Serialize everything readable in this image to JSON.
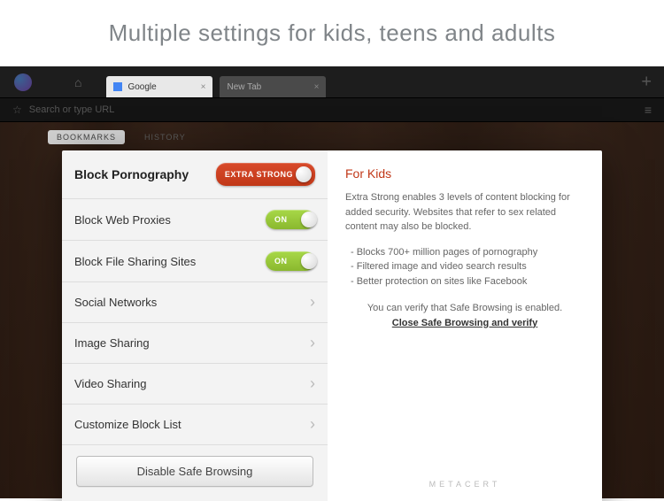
{
  "banner_text": "Multiple settings for kids, teens and adults",
  "browser": {
    "tab_active_label": "Google",
    "tab_inactive_label": "New Tab",
    "url_placeholder": "Search or type URL"
  },
  "sub_tabs": {
    "bookmarks": "BOOKMARKS",
    "history": "HISTORY"
  },
  "settings": {
    "block_porn": {
      "label": "Block Pornography",
      "pill": "EXTRA STRONG"
    },
    "block_proxies": {
      "label": "Block Web Proxies",
      "state": "ON"
    },
    "block_filesharing": {
      "label": "Block File Sharing Sites",
      "state": "ON"
    },
    "social": {
      "label": "Social Networks"
    },
    "image_sharing": {
      "label": "Image Sharing"
    },
    "video_sharing": {
      "label": "Video Sharing"
    },
    "custom_block": {
      "label": "Customize Block List"
    },
    "disable_button": "Disable Safe Browsing"
  },
  "info": {
    "title": "For Kids",
    "description": "Extra Strong enables 3 levels of content blocking for added security. Websites that refer to sex related content may also be blocked.",
    "bullets": {
      "b1": "- Blocks 700+ million pages of pornography",
      "b2": "- Filtered image and video search results",
      "b3": "- Better protection on sites like Facebook"
    },
    "verify_line": "You can verify that Safe Browsing is enabled.",
    "verify_link": "Close Safe Browsing and verify",
    "brand": "METACERT"
  }
}
